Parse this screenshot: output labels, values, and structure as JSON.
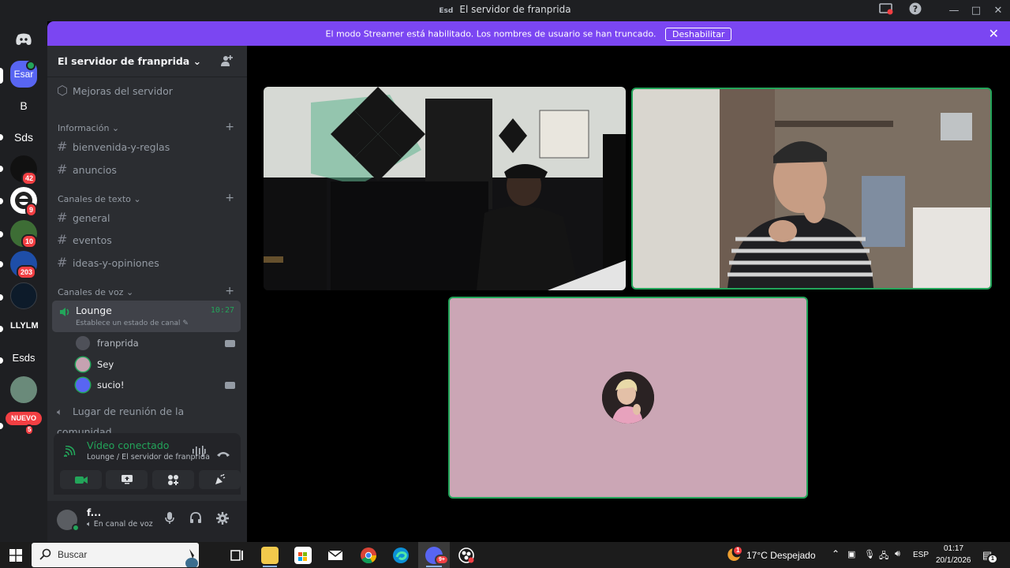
{
  "window": {
    "title": "El servidor de franprida",
    "help_icon": "question-mark-icon",
    "minimize_icon": "minimize-icon",
    "maximize_icon": "maximize-icon",
    "close_icon": "close-icon"
  },
  "banner": {
    "message": "El modo Streamer está habilitado. Los nombres de usuario se han truncado.",
    "disable_label": "Deshabilitar",
    "color": "#7b46f2"
  },
  "guilds": [
    {
      "label": "Esar",
      "badge": ""
    },
    {
      "label": "B",
      "badge": ""
    },
    {
      "label": "Sds",
      "badge": ""
    },
    {
      "label": "",
      "badge": "42"
    },
    {
      "label": "",
      "badge": "9"
    },
    {
      "label": "",
      "badge": "10"
    },
    {
      "label": "",
      "badge": "203"
    },
    {
      "label": "",
      "badge": ""
    },
    {
      "label": "LLYLM",
      "badge": ""
    },
    {
      "label": "Esds",
      "badge": ""
    },
    {
      "label": "",
      "badge": ""
    },
    {
      "label": "NUEVO",
      "badge": "5"
    }
  ],
  "server": {
    "name": "El servidor de franprida",
    "boost": "Mejoras del servidor"
  },
  "categories": {
    "info": "Información",
    "text": "Canales de texto",
    "voice": "Canales de voz"
  },
  "channels": {
    "info": [
      "bienvenida-y-reglas",
      "anuncios"
    ],
    "text": [
      "general",
      "eventos",
      "ideas-y-opiniones"
    ],
    "voice_extra": "Lugar de reunión de la comunidad"
  },
  "lounge": {
    "name": "Lounge",
    "time": "10:27",
    "status": "Establece un estado de canal",
    "users": [
      "franprida",
      "Sey",
      "sucio!"
    ]
  },
  "voice_panel": {
    "title": "Vídeo conectado",
    "subtitle": "Lounge / El servidor de franprida"
  },
  "user_panel": {
    "name": "f...",
    "status": "En canal de voz"
  },
  "taskbar": {
    "search_placeholder": "Buscar",
    "weather": "17°C  Despejado",
    "weather_badge": "1",
    "language": "ESP",
    "time": "01:17",
    "date": "20/1/2026",
    "notif_badge": "1"
  },
  "colors": {
    "accent_green": "#23a55a",
    "sidebar": "#2b2d31",
    "rail": "#1e1f22"
  }
}
